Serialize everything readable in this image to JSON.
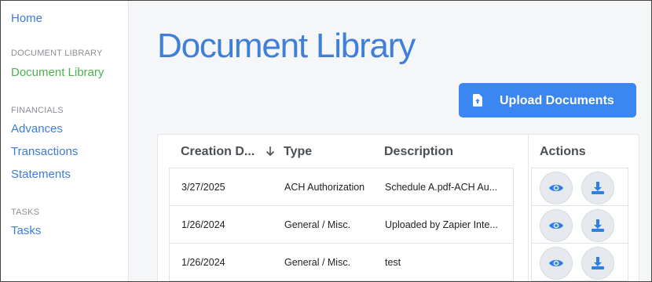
{
  "sidebar": {
    "home": "Home",
    "section_document_library": "DOCUMENT LIBRARY",
    "document_library": "Document Library",
    "section_financials": "FINANCIALS",
    "advances": "Advances",
    "transactions": "Transactions",
    "statements": "Statements",
    "section_tasks": "TASKS",
    "tasks": "Tasks"
  },
  "main": {
    "title": "Document Library",
    "upload_button": "Upload Documents",
    "icons": {
      "upload": "file-upload-icon",
      "sort": "arrow-down-icon",
      "view": "eye-icon",
      "download": "download-icon"
    },
    "colors": {
      "accent": "#3b86f0",
      "active_nav": "#4caf50",
      "link": "#3b7dd8"
    }
  },
  "table": {
    "headers": {
      "creation_date": "Creation D...",
      "type": "Type",
      "description": "Description",
      "actions": "Actions"
    },
    "rows": [
      {
        "date": "3/27/2025",
        "type": "ACH Authorization",
        "description": "Schedule A.pdf-ACH Au..."
      },
      {
        "date": "1/26/2024",
        "type": "General / Misc.",
        "description": "Uploaded by Zapier Inte..."
      },
      {
        "date": "1/26/2024",
        "type": "General / Misc.",
        "description": "test"
      }
    ]
  }
}
